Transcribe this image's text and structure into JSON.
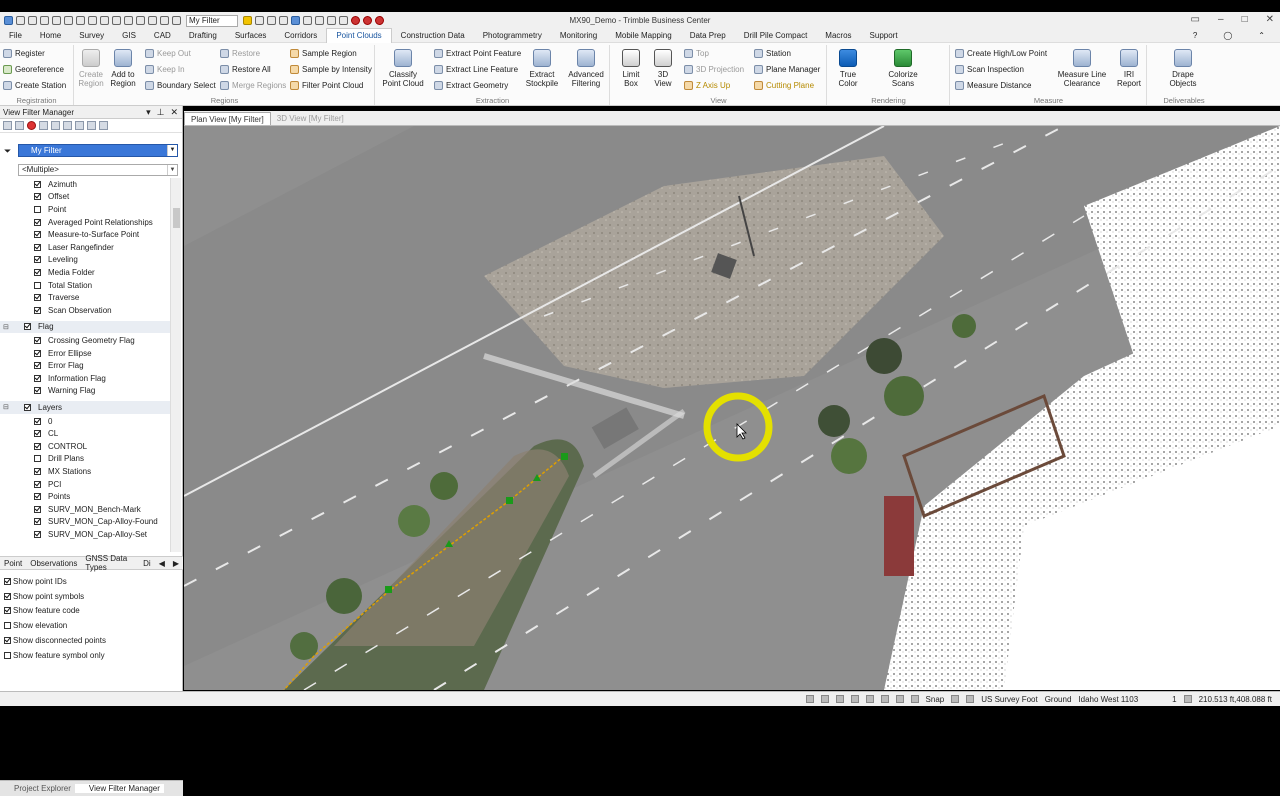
{
  "window": {
    "title": "MX90_Demo - Trimble Business Center",
    "filter_box": "My Filter"
  },
  "menu": [
    "File",
    "Home",
    "Survey",
    "GIS",
    "CAD",
    "Drafting",
    "Surfaces",
    "Corridors",
    "Point Clouds",
    "Construction Data",
    "Photogrammetry",
    "Monitoring",
    "Mobile Mapping",
    "Data Prep",
    "Drill Pile Compact",
    "Macros",
    "Support"
  ],
  "active_menu": "Point Clouds",
  "ribbon": {
    "registration": {
      "label": "Registration",
      "register": "Register",
      "georeference": "Georeference",
      "create_station": "Create Station"
    },
    "regions": {
      "label": "Regions",
      "create_region": "Create Region",
      "add_to_region": "Add to Region",
      "keep_out": "Keep Out",
      "keep_in": "Keep In",
      "boundary_select": "Boundary Select",
      "restore": "Restore",
      "restore_all": "Restore All",
      "merge_regions": "Merge Regions",
      "sample_region": "Sample Region",
      "sample_by_intensity": "Sample by Intensity",
      "filter_point_cloud": "Filter Point Cloud"
    },
    "extraction": {
      "label": "Extraction",
      "classify": "Classify Point Cloud",
      "extract_point_feature": "Extract Point Feature",
      "extract_line_feature": "Extract Line Feature",
      "extract_geometry": "Extract Geometry",
      "extract_stockpile": "Extract Stockpile",
      "advanced_filtering": "Advanced Filtering"
    },
    "view": {
      "label": "View",
      "limit_box": "Limit Box",
      "view_3d": "3D View",
      "top": "Top",
      "projection_3d": "3D Projection",
      "z_axis_up": "Z Axis Up",
      "station": "Station",
      "plane_manager": "Plane Manager",
      "cutting_plane": "Cutting Plane"
    },
    "rendering": {
      "label": "Rendering",
      "true_color": "True Color",
      "colorize_scans": "Colorize Scans"
    },
    "measure": {
      "label": "Measure",
      "create_high_low": "Create High/Low Point",
      "scan_inspection": "Scan Inspection",
      "measure_distance": "Measure Distance",
      "measure_line_clearance": "Measure Line Clearance",
      "iri_report": "IRI Report"
    },
    "deliverables": {
      "label": "Deliverables",
      "drape_objects": "Drape Objects"
    }
  },
  "left_panel": {
    "title": "View Filter Manager",
    "filter": "My Filter",
    "multiple": "<Multiple>",
    "items_group1": [
      "Azimuth",
      "Offset",
      "Point",
      "Averaged Point Relationships",
      "Measure-to-Surface Point",
      "Laser Rangefinder",
      "Leveling",
      "Media Folder",
      "Total Station",
      "Traverse",
      "Scan Observation"
    ],
    "items_group1_checked": [
      true,
      true,
      false,
      true,
      true,
      true,
      true,
      true,
      false,
      true,
      true
    ],
    "flag_header": "Flag",
    "flag_items": [
      "Crossing Geometry Flag",
      "Error Ellipse",
      "Error Flag",
      "Information Flag",
      "Warning Flag"
    ],
    "layers_header": "Layers",
    "layer_items": [
      "0",
      "CL",
      "CONTROL",
      "Drill Plans",
      "MX Stations",
      "PCI",
      "Points",
      "SURV_MON_Bench-Mark",
      "SURV_MON_Cap-Alloy-Found",
      "SURV_MON_Cap-Alloy-Set"
    ],
    "layer_checked": [
      true,
      true,
      true,
      false,
      true,
      true,
      true,
      true,
      true,
      true
    ],
    "tabs": [
      "Point",
      "Observations",
      "GNSS Data Types",
      "Di"
    ],
    "options": [
      "Show point IDs",
      "Show point symbols",
      "Show feature code",
      "Show elevation",
      "Show disconnected points",
      "Show feature symbol only"
    ],
    "options_checked": [
      true,
      true,
      true,
      false,
      true,
      false
    ],
    "bottom_tabs": [
      "Project Explorer",
      "View Filter Manager"
    ]
  },
  "view_tabs": [
    "Plan View [My Filter]",
    "3D View [My Filter]"
  ],
  "status": {
    "snap": "Snap",
    "units": "US Survey Foot",
    "ground": "Ground",
    "zone": "Idaho West 1103",
    "page": "1",
    "coords": "210.513 ft,408.088 ft"
  },
  "colors": {
    "ribbon_active": "#1a56a0",
    "filter_sel": "#3a77d8",
    "cursor_ring": "#e4e000"
  }
}
